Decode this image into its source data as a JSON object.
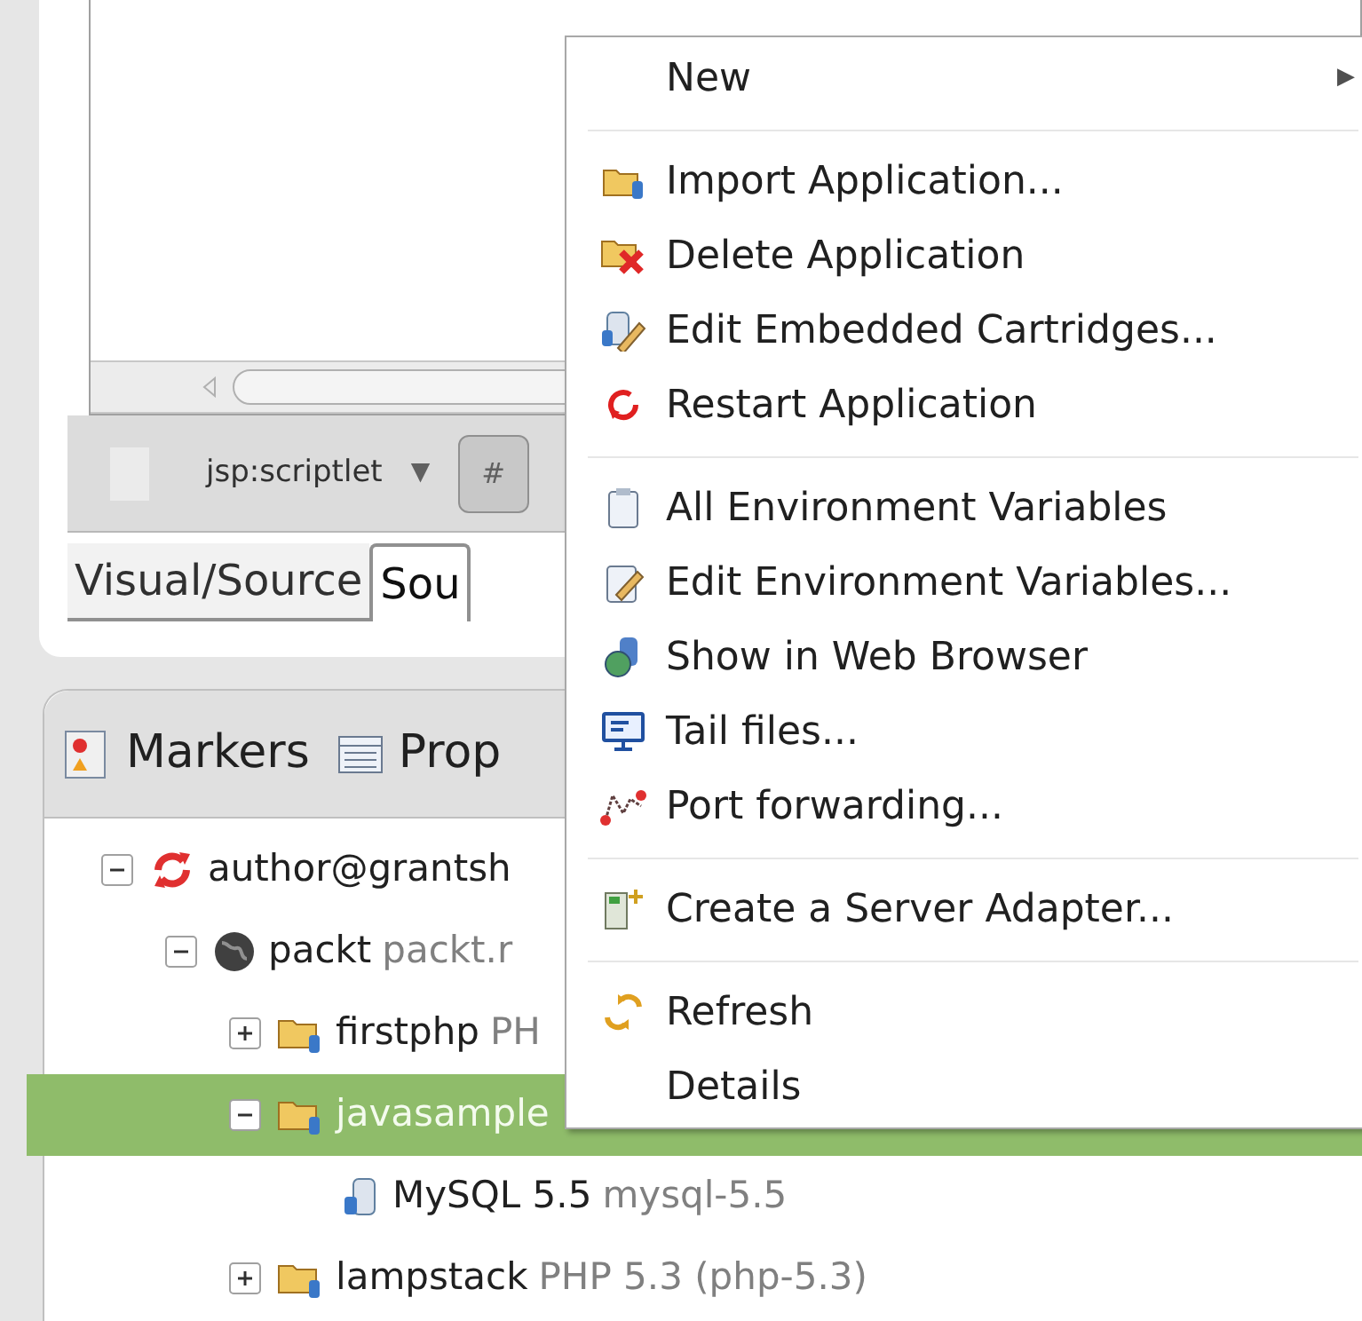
{
  "editor": {
    "toolbar_label": "jsp:scriptlet",
    "dropdown_arrow": "▼",
    "button_text": "#"
  },
  "editor_tabs": [
    {
      "label": "Visual/Source",
      "selected": false
    },
    {
      "label": "Sou",
      "selected": true
    }
  ],
  "bottom_panel": {
    "tabs": [
      {
        "label": "Markers",
        "kind": "markers"
      },
      {
        "label": "Prop",
        "kind": "properties"
      }
    ]
  },
  "tree": [
    {
      "name": "author@grantsh",
      "kind": "connection",
      "expanded": true,
      "selected": false,
      "children": [
        {
          "name": "packt",
          "detail": "packt.r",
          "kind": "domain",
          "expanded": true,
          "selected": false,
          "children": [
            {
              "name": "firstphp",
              "detail": "PH",
              "kind": "application",
              "expanded": false,
              "selected": false
            },
            {
              "name": "javasample",
              "kind": "application",
              "expanded": true,
              "selected": true,
              "children": [
                {
                  "name": "MySQL 5.5",
                  "detail": "mysql-5.5",
                  "kind": "cartridge",
                  "selected": false
                }
              ]
            },
            {
              "name": "lampstack",
              "detail": "PHP 5.3 (php-5.3)",
              "kind": "application",
              "expanded": false,
              "selected": false
            }
          ]
        }
      ]
    }
  ],
  "context_menu": [
    {
      "kind": "submenu",
      "label": "New",
      "arrow": "▶"
    },
    {
      "kind": "separator"
    },
    {
      "kind": "item",
      "label": "Import Application..."
    },
    {
      "kind": "item",
      "label": "Delete Application"
    },
    {
      "kind": "item",
      "label": "Edit Embedded Cartridges..."
    },
    {
      "kind": "item",
      "label": "Restart Application"
    },
    {
      "kind": "separator"
    },
    {
      "kind": "item",
      "label": "All Environment Variables"
    },
    {
      "kind": "item",
      "label": "Edit Environment Variables..."
    },
    {
      "kind": "item",
      "label": "Show in Web Browser"
    },
    {
      "kind": "item",
      "label": "Tail files..."
    },
    {
      "kind": "item",
      "label": "Port forwarding..."
    },
    {
      "kind": "separator"
    },
    {
      "kind": "item",
      "label": "Create a Server Adapter..."
    },
    {
      "kind": "separator"
    },
    {
      "kind": "item",
      "label": "Refresh"
    },
    {
      "kind": "item",
      "label": "Details"
    }
  ]
}
